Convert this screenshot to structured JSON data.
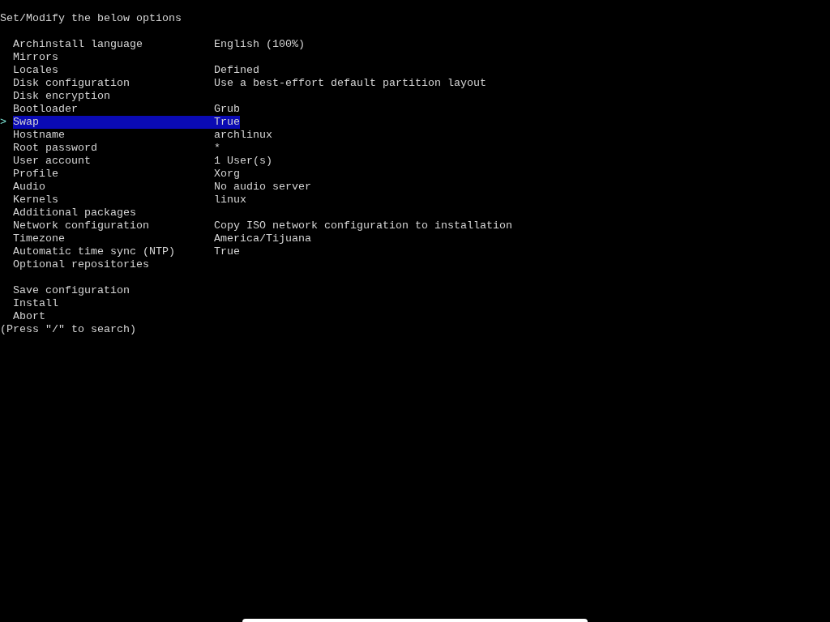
{
  "title": "Set/Modify the below options",
  "options": [
    {
      "label": "Archinstall language",
      "value": "English (100%)",
      "selected": false
    },
    {
      "label": "Mirrors",
      "selected": false
    },
    {
      "label": "Locales",
      "value": "Defined",
      "selected": false
    },
    {
      "label": "Disk configuration",
      "value": "Use a best-effort default partition layout",
      "selected": false
    },
    {
      "label": "Disk encryption",
      "selected": false
    },
    {
      "label": "Bootloader",
      "value": "Grub",
      "selected": false
    },
    {
      "label": "Swap",
      "value": "True",
      "selected": true
    },
    {
      "label": "Hostname",
      "value": "archlinux",
      "selected": false
    },
    {
      "label": "Root password",
      "value": "*",
      "selected": false
    },
    {
      "label": "User account",
      "value": "1 User(s)",
      "selected": false
    },
    {
      "label": "Profile",
      "value": "Xorg",
      "selected": false
    },
    {
      "label": "Audio",
      "value": "No audio server",
      "selected": false
    },
    {
      "label": "Kernels",
      "value": "linux",
      "selected": false
    },
    {
      "label": "Additional packages",
      "selected": false
    },
    {
      "label": "Network configuration",
      "value": "Copy ISO network configuration to installation",
      "selected": false
    },
    {
      "label": "Timezone",
      "value": "America/Tijuana",
      "selected": false
    },
    {
      "label": "Automatic time sync (NTP)",
      "value": "True",
      "selected": false
    },
    {
      "label": "Optional repositories",
      "selected": false
    }
  ],
  "actions": [
    {
      "label": "Save configuration",
      "selected": false
    },
    {
      "label": "Install",
      "selected": false
    },
    {
      "label": "Abort",
      "selected": false
    }
  ],
  "cursor": ">",
  "hint": "(Press \"/\" to search)"
}
